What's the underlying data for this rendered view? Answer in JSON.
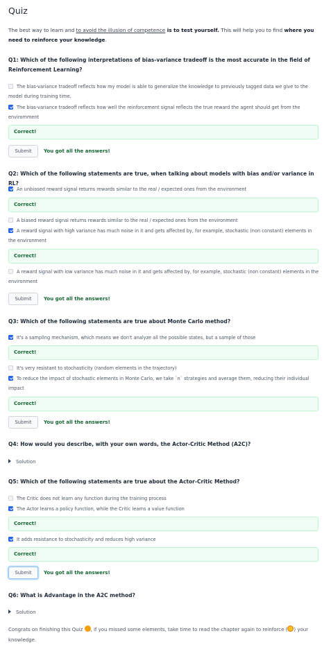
{
  "page_title": "Quiz",
  "intro": {
    "p1": "The best way to learn and ",
    "link": "to avoid the illusion of competence",
    "p2": " is to test yourself.",
    "p3": " This will help you to find ",
    "p4": "where you need to reinforce your knowledge",
    "p5": "."
  },
  "submit_label": "Submit",
  "correct_label": "Correct!",
  "success_label": "You got all the answers!",
  "solution_label": "Solution",
  "q1": {
    "question": "Q1: Which of the following interpretations of bias-variance tradeoff is the most accurate in the field of Reinforcement Learning?",
    "options": [
      {
        "text": "The bias-variance tradeoff reflects how my model is able to generalize the knowledge to previously tagged data we give to the model during training time.",
        "checked": false
      },
      {
        "text": "The bias-variance tradeoff reflects how well the reinforcement signal reflects the true reward the agent should get from the enviromment",
        "checked": true
      }
    ]
  },
  "q2": {
    "question": "Q2: Which of the following statements are true, when talking about models with bias and/or variance in RL?",
    "options": [
      {
        "text": "An unbiased reward signal returns rewards similar to the real / expected ones from the environment",
        "checked": true
      },
      {
        "text": "A biased reward signal returns rewards similar to the real / expected ones from the environment",
        "checked": false
      },
      {
        "text": "A reward signal with high variance has much noise in it and gets affected by, for example, stochastic (non constant) elements in the environment",
        "checked": true
      },
      {
        "text": "A reward signal with low variance has much noise in it and gets affected by, for example, stochastic (non constant) elements in the environment",
        "checked": false
      }
    ]
  },
  "q3": {
    "question": "Q3: Which of the following statements are true about Monte Carlo method?",
    "options": [
      {
        "text": "It's a sampling mechanism, which means we don't analyze all the possible states, but a sample of those",
        "checked": true
      },
      {
        "text": "It's very resistant to stochasticity (random elements in the trajectory)",
        "checked": false
      },
      {
        "text": "To reduce the impact of stochastic elements in Monte Carlo, we take `n` strategies and average them, reducing their individual impact",
        "checked": true
      }
    ]
  },
  "q4": {
    "question": "Q4: How would you describe, with your own words, the Actor-Critic Method (A2C)?"
  },
  "q5": {
    "question": "Q5: Which of the following statements are true about the Actor-Critic Method?",
    "options": [
      {
        "text": "The Critic does not learn any function during the training process",
        "checked": false
      },
      {
        "text": "The Actor learns a policy function, while the Critic learns a value function",
        "checked": true
      },
      {
        "text": "It adds resistance to stochasticity and reduces high variance",
        "checked": true
      }
    ]
  },
  "q6": {
    "question": "Q6: What is Advantage in the A2C method?"
  },
  "footer": {
    "p1": "Congrats on finishing this Quiz ",
    "p2": ", if you missed some elements, take time to read the chapter again to reinforce (",
    "p3": ") your knowledge."
  },
  "icons": {
    "checked": "checkbox-checked-icon",
    "unchecked": "checkbox-unchecked-icon",
    "disclosure": "triangle-right-icon",
    "party": "party-emoji-icon",
    "nerd": "nerd-face-emoji-icon"
  },
  "colors": {
    "accent": "#2563eb",
    "success_text": "#166534",
    "success_bg": "#f0fdf4",
    "success_border": "#bbf7d0"
  }
}
